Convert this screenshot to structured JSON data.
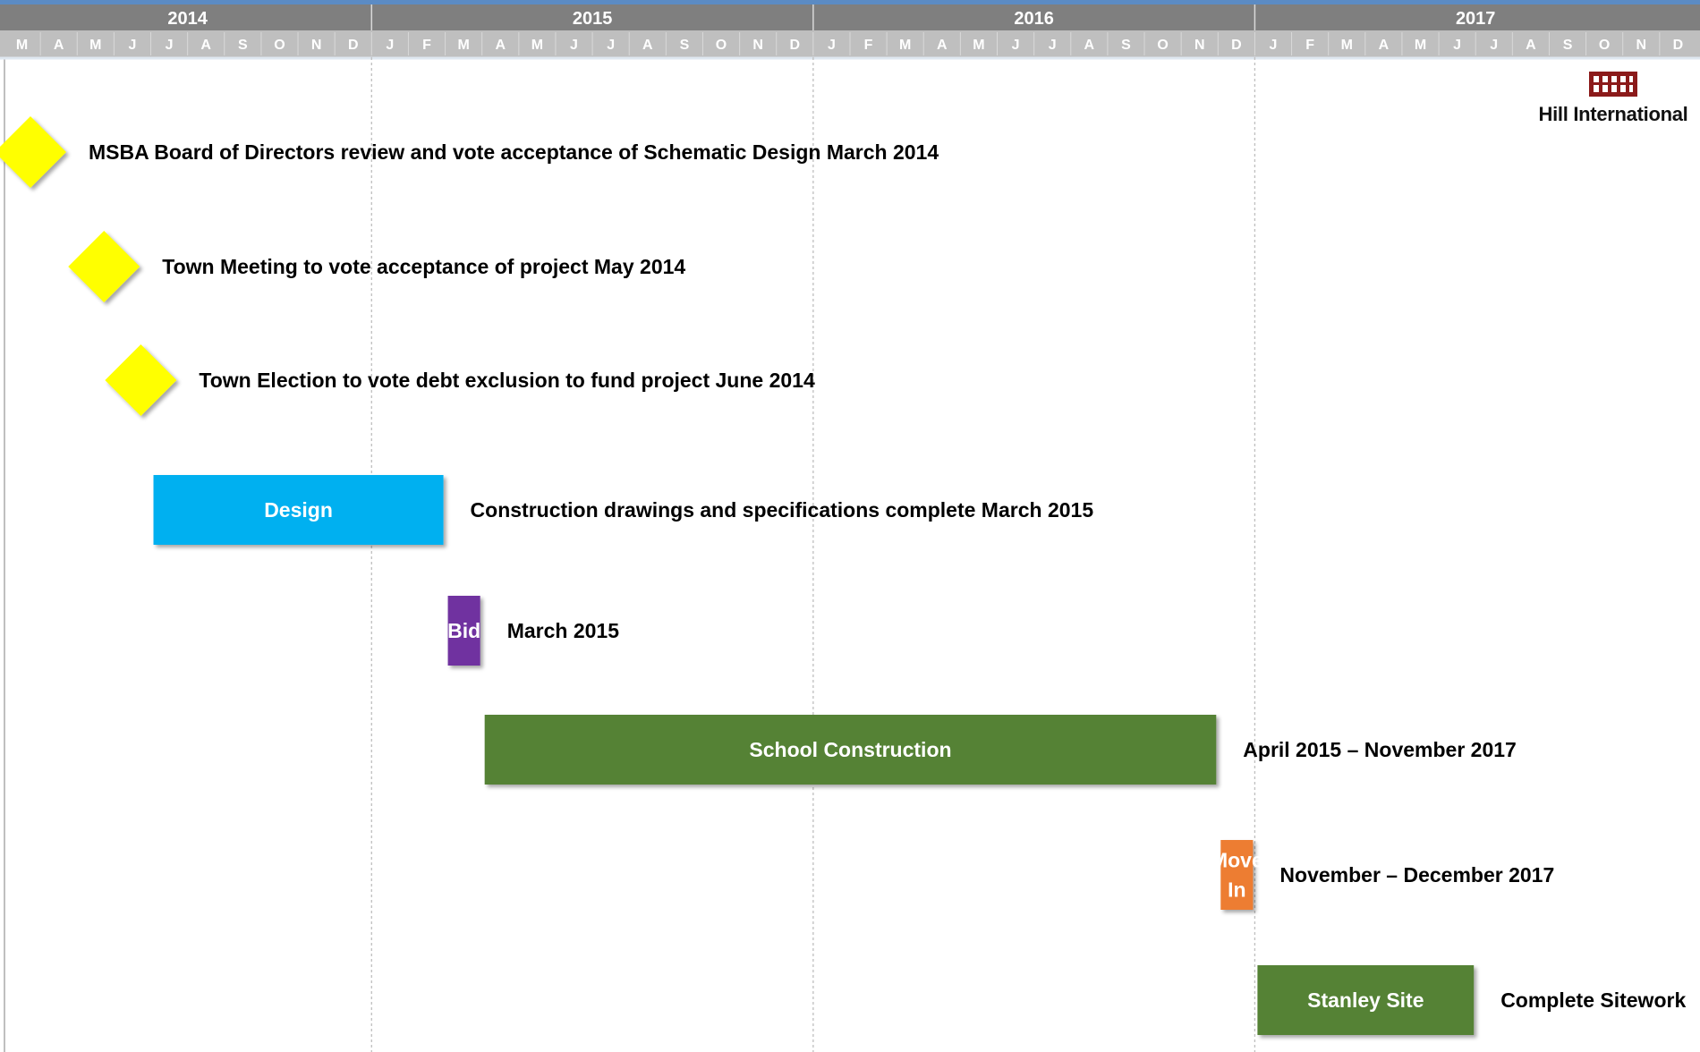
{
  "logo": {
    "text": "Hill International",
    "color": "#8b1a1a"
  },
  "colors": {
    "header_year_bg": "#7f7f7f",
    "header_month_bg": "#bfbfbf",
    "top_border": "#5b8bc4",
    "gridline": "#bfbfbf",
    "milestone": "#ffff00"
  },
  "chart_data": {
    "type": "gantt",
    "timeline": {
      "start": "2014-03",
      "end": "2017-12",
      "years": [
        "2014",
        "2015",
        "2016",
        "2017"
      ],
      "months": [
        "M",
        "A",
        "M",
        "J",
        "J",
        "A",
        "S",
        "O",
        "N",
        "D",
        "J",
        "F",
        "M",
        "A",
        "M",
        "J",
        "J",
        "A",
        "S",
        "O",
        "N",
        "D",
        "J",
        "F",
        "M",
        "A",
        "M",
        "J",
        "J",
        "A",
        "S",
        "O",
        "N",
        "D",
        "J",
        "F",
        "M",
        "A",
        "M",
        "J",
        "J",
        "A",
        "S",
        "O",
        "N",
        "D"
      ]
    },
    "tasks": [
      {
        "kind": "milestone",
        "date": "2014-03",
        "label": "MSBA Board of Directors review and vote acceptance of Schematic Design March 2014",
        "color": "#ffff00"
      },
      {
        "kind": "milestone",
        "date": "2014-05",
        "label": "Town Meeting to vote acceptance of project May 2014",
        "color": "#ffff00"
      },
      {
        "kind": "milestone",
        "date": "2014-06",
        "label": "Town Election to vote debt exclusion to fund project June 2014",
        "color": "#ffff00"
      },
      {
        "kind": "bar",
        "start": "2014-07",
        "end": "2015-02",
        "bar_text": [
          "Design"
        ],
        "label": "Construction drawings and specifications complete March 2015",
        "color": "#00b0f0"
      },
      {
        "kind": "bar",
        "start": "2015-03",
        "end": "2015-03",
        "bar_text": [
          "Bid"
        ],
        "label": "March 2015",
        "color": "#7030a0"
      },
      {
        "kind": "bar",
        "start": "2015-04",
        "end": "2016-11",
        "bar_text": [
          "School Construction"
        ],
        "label": "April 2015 – November 2017",
        "color": "#548235"
      },
      {
        "kind": "bar",
        "start": "2016-12",
        "end": "2016-12",
        "bar_text": [
          "Move",
          "In"
        ],
        "label": "November – December 2017",
        "color": "#ed7d31"
      },
      {
        "kind": "bar",
        "start": "2017-01",
        "end": "2017-06",
        "bar_text": [
          "Stanley Site"
        ],
        "label": "Complete Sitework",
        "color": "#548235"
      }
    ]
  }
}
